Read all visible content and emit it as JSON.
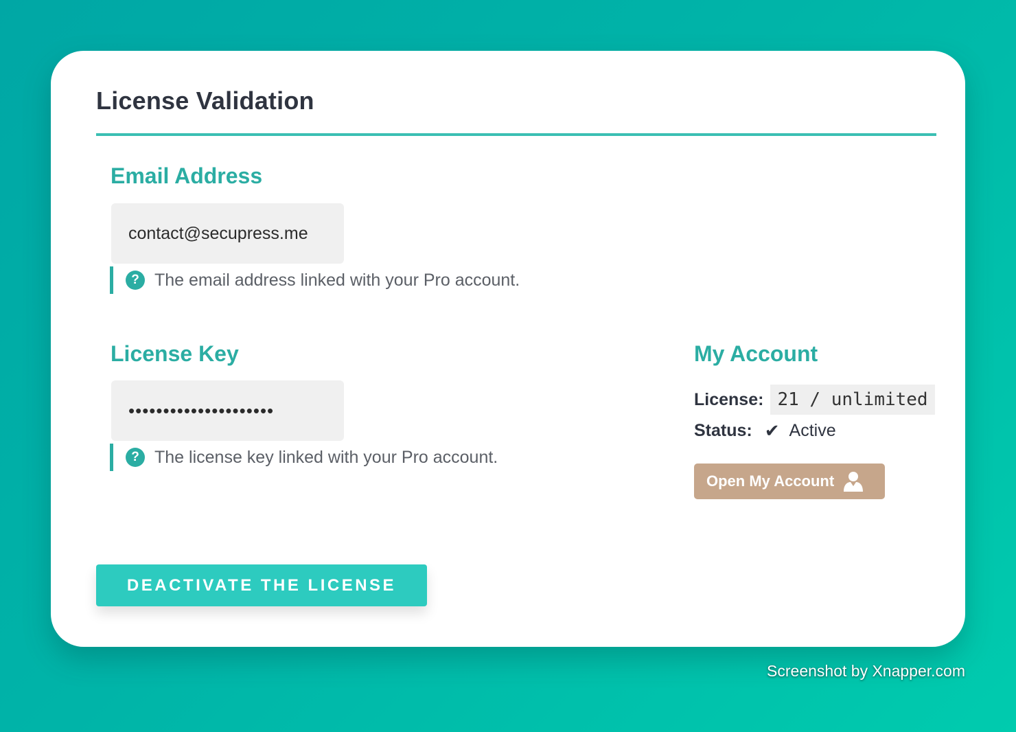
{
  "section": {
    "title": "License Validation"
  },
  "email": {
    "label": "Email Address",
    "value": "contact@secupress.me",
    "help": "The email address linked with your Pro account."
  },
  "license_key": {
    "label": "License Key",
    "value": "•••••••••••••••••••••",
    "help": "The license key linked with your Pro account."
  },
  "account": {
    "title": "My Account",
    "license_label": "License:",
    "license_value": "21 / unlimited",
    "status_label": "Status:",
    "status_icon": "check-icon",
    "status_value": "Active",
    "open_button": "Open My Account",
    "open_button_icon": "user-icon"
  },
  "actions": {
    "deactivate_label": "DEACTIVATE THE LICENSE"
  },
  "help_icon": "question-icon",
  "footer": {
    "credit": "Screenshot by Xnapper.com"
  },
  "colors": {
    "accent": "#2bada3",
    "button_primary": "#2dcbbf",
    "button_account": "#c6a68b"
  }
}
